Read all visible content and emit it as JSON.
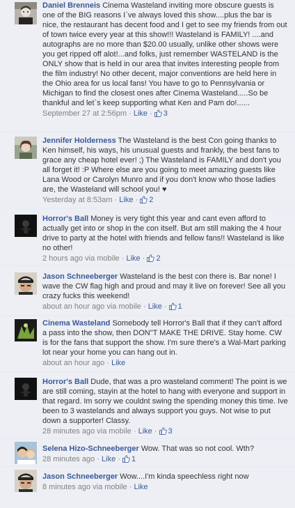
{
  "comments": [
    {
      "author": "Daniel Brenneis",
      "text": "Cinema Wasteland inviting more obscure guests is one of the BIG reasons I`ve always loved this show....plus the bar is nice, the restaurant has decent food and I get to see my friends from out of town twice every year at this show!!! Wasteland is FAMILY! ....and autographs are no more than $20.00 usually, unlike other shows were you get ripped off alot!...and folks, just remember WASTELAND is the ONLY show that is held in our area that invites interesting people from the film industry! No other decent, major conventions are held here in the Ohio area for us local fans! You have to go to Pennsylvania or Michigan to find the closest ones after Cinema Wasteland.....So be thankful and let`s keep supporting what Ken and Pam do!......",
      "time": "September 27 at 2:56pm",
      "like_label": "Like",
      "like_count": "3"
    },
    {
      "author": "Jennifer Holderness",
      "text": "The Wasteland is the best Con going thanks to Ken himself, his ways, his unusual guests and frankly, the best fans to grace any cheap hotel ever! ;) The Wasteland is FAMILY and don't you all forget it! :P Where else are you going to meet amazing guests like Lana Wood or Carolyn Munro and if you don't know who those ladies are, the Wasteland will school you! ♥",
      "time": "Yesterday at 8:53am",
      "like_label": "Like",
      "like_count": "2"
    },
    {
      "author": "Horror's Ball",
      "text": "Money is very tight this year and cant even afford to actually get into or shop in the con itself. But am still making the 4 hour drive to party at the hotel with friends and fellow fans!! Wasteland is like no other!",
      "time": "2 hours ago via mobile",
      "like_label": "Like",
      "like_count": "2"
    },
    {
      "author": "Jason Schneeberger",
      "text": "Wasteland is the best con there is. Bar none! I wave the CW flag high and proud and may it live on forever! See all you crazy fucks this weekend!",
      "time": "about an hour ago via mobile",
      "like_label": "Like",
      "like_count": "1"
    },
    {
      "author": "Cinema Wasteland",
      "text": "Somebody tell Horror's Ball that if they can't afford a pass into the show, then DON\"T MAKE THE DRIVE. Stay home. CW is for the fans that support the show. I'm sure there's a Wal-Mart parking lot near your home you can hang out in.",
      "time": "about an hour ago",
      "like_label": "Like",
      "like_count": null
    },
    {
      "author": "Horror's Ball",
      "text": "Dude, that was a pro wasteland comment! The point is we are still coming, stayin at the hotel to hang with everyone and support in that regard. Im sorry we couldnt swing the spending money this time. Ive been to 3 wastelands and always support you guys. Not wise to put down a supporter! Classy.",
      "time": "28 minutes ago via mobile",
      "like_label": "Like",
      "like_count": "3"
    },
    {
      "author": "Selena Hizo-Schneeberger",
      "text": "Wow. That was so not cool. Wth?",
      "time": "28 minutes ago",
      "like_label": "Like",
      "like_count": "1"
    },
    {
      "author": "Jason Schneeberger",
      "text": "Wow....I'm kinda speechless right now",
      "time": "8 minutes ago via mobile",
      "like_label": "Like",
      "like_count": null
    }
  ],
  "separator": "·",
  "colors": {
    "author_link": "#3b5998",
    "comment_bg": "#edeff4",
    "meta_text": "#808080",
    "body_text": "#333333"
  },
  "icons": {
    "like_count": "thumbs-up-icon"
  }
}
